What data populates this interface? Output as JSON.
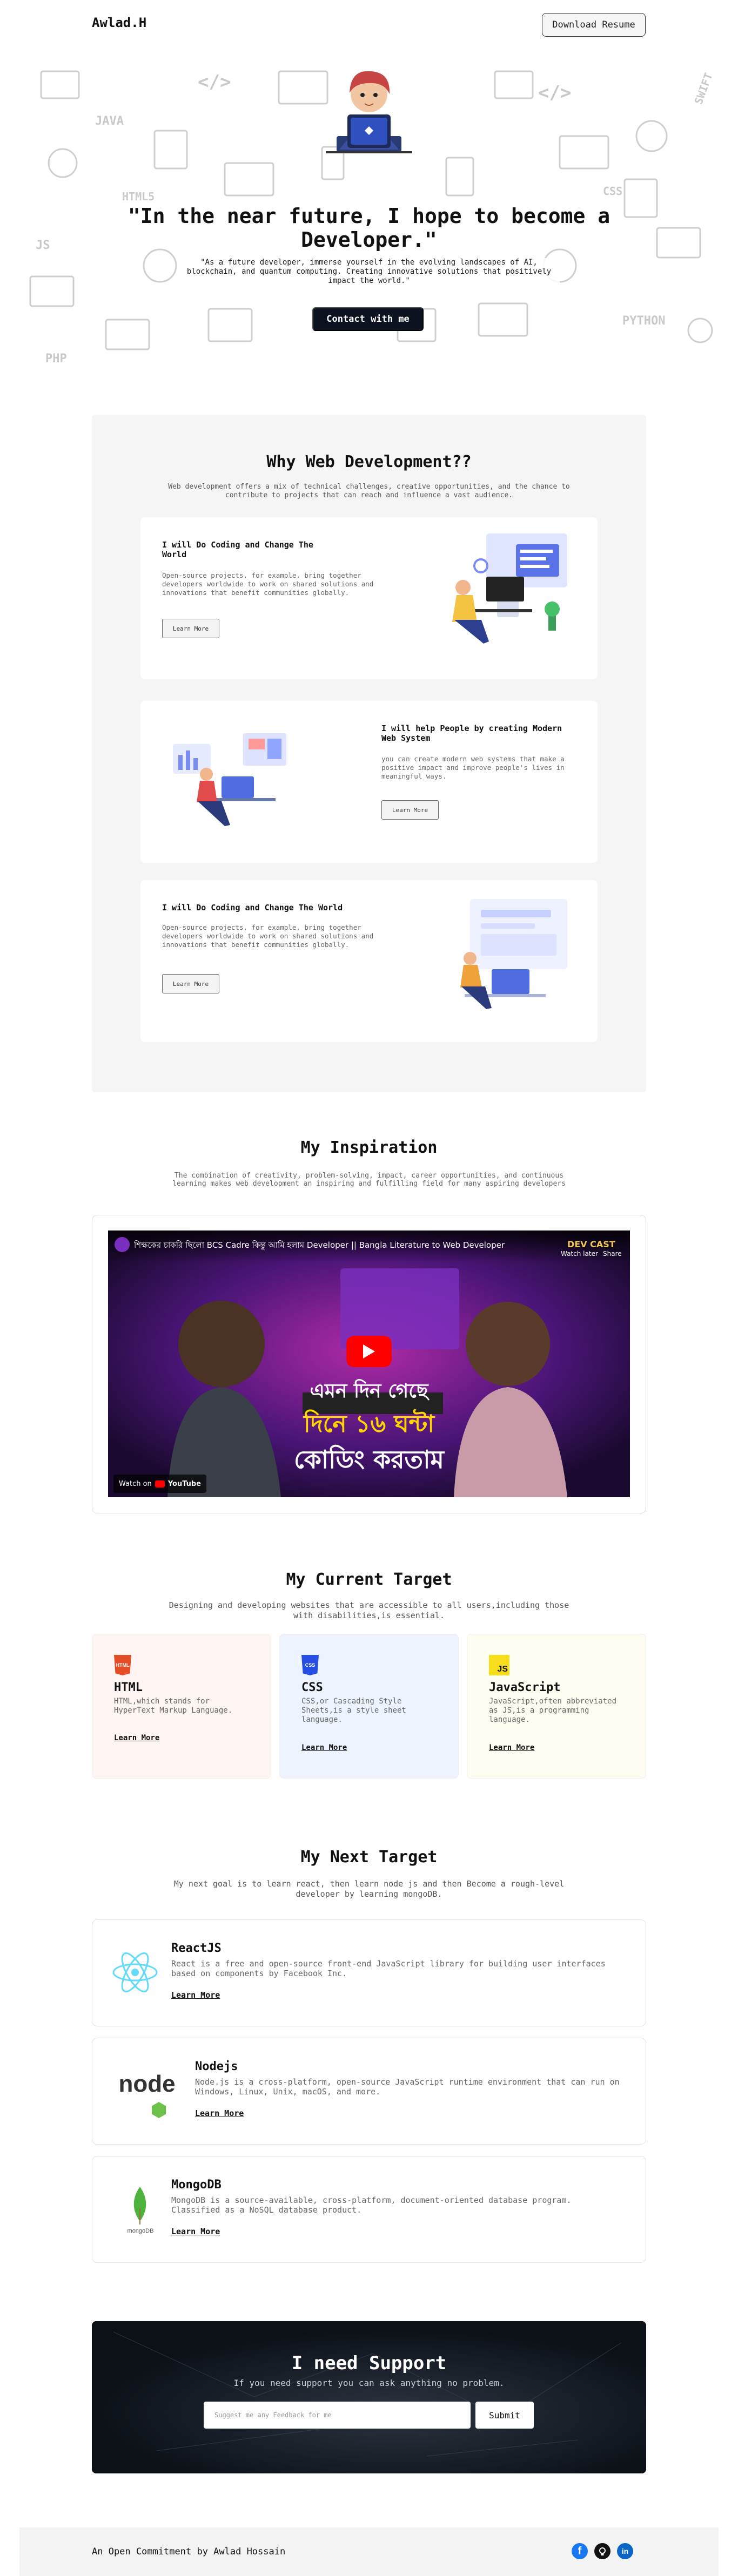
{
  "nav": {
    "logo": "Awlad.H",
    "download_label": "Download Resume"
  },
  "hero": {
    "quote": "\"In the near future, I hope to become a Developer.\"",
    "subtitle": "\"As a future developer, immerse yourself in the evolving landscapes of AI, blockchain, and quantum computing. Creating innovative solutions that positively impact the world.\"",
    "contact_label": "Contact with me",
    "doodles": [
      "JAVA",
      "PHP",
      "HTML5",
      "PYTHON",
      "SWIFT",
      "CSS",
      "JS",
      "</>"
    ]
  },
  "why": {
    "title": "Why Web Development??",
    "subtitle": "Web development offers a mix of technical challenges, creative opportunities, and the chance to contribute to projects that can reach and influence a vast audience.",
    "cards": [
      {
        "title": "I will Do Coding and Change The World",
        "text": "Open-source projects, for example, bring together developers worldwide to work on shared solutions and innovations that benefit communities globally.",
        "button": "Learn More"
      },
      {
        "title": "I will help People by creating Modern Web System",
        "text": "you can create modern web systems that make a positive impact and improve people's lives in meaningful ways.",
        "button": "Learn More"
      },
      {
        "title": "I will Do Coding and Change The World",
        "text": "Open-source projects, for example, bring together developers worldwide to work on shared solutions and innovations that benefit communities globally.",
        "button": "Learn More"
      }
    ]
  },
  "inspiration": {
    "title": "My Inspiration",
    "subtitle": "The combination of creativity, problem-solving, impact, career opportunities, and continuous learning makes web development an inspiring and fulfilling field for many aspiring developers",
    "video": {
      "title": "শিক্ষকের চাকরি ছিলো BCS Cadre কিন্তু আমি হলাম Developer || Bangla Literature to Web Developer",
      "watch_later": "Watch later",
      "share": "Share",
      "watch_on": "Watch on",
      "platform": "YouTube",
      "banner_line1": "এমন দিন গেছে",
      "banner_line2": "দিনে ১৬ ঘন্টা",
      "banner_line3": "কোডিং করতাম",
      "badge": "DEV CAST"
    }
  },
  "target": {
    "title": "My Current Target",
    "subtitle": "Designing and developing websites that are accessible to all users,including those with disabilities,is essential.",
    "cards": [
      {
        "icon_text": "HTML",
        "name": "HTML",
        "text": "HTML,which stands for HyperText Markup Language.",
        "link": "Learn More",
        "bg": "#fff5f2",
        "accent": "#e44d26"
      },
      {
        "icon_text": "CSS",
        "name": "CSS",
        "text": "CSS,or Cascading Style Sheets,is a style sheet language.",
        "link": "Learn More",
        "bg": "#eef4ff",
        "accent": "#264de4"
      },
      {
        "icon_text": "JS",
        "name": "JavaScript",
        "text": "JavaScript,often abbreviated as JS,is a programming language.",
        "link": "Learn More",
        "bg": "#fffdf1",
        "accent": "#f7df1e"
      }
    ]
  },
  "next": {
    "title": "My Next Target",
    "subtitle": "My next goal is to learn react, then learn node js and then Become a rough-level developer by learning mongoDB.",
    "cards": [
      {
        "name": "ReactJS",
        "text": "React is a free and open-source front-end JavaScript library for building user interfaces based on components by Facebook Inc.",
        "link": "Learn More"
      },
      {
        "name": "Nodejs",
        "text": "Node.js is a cross-platform, open-source JavaScript runtime environment that can run on Windows, Linux, Unix, macOS, and more.",
        "link": "Learn More",
        "logo_text": "node"
      },
      {
        "name": "MongoDB",
        "text": "MongoDB is a source-available, cross-platform, document-oriented database program. Classified as a NoSQL database product.",
        "link": "Learn More",
        "logo_text": "mongoDB"
      }
    ]
  },
  "support": {
    "title": "I need Support",
    "subtitle": "If you need support you can ask anything no problem.",
    "placeholder": "Suggest me any Feedback for me",
    "submit": "Submit"
  },
  "footer": {
    "text": "An Open Commitment by Awlad Hossain",
    "social": [
      "facebook-icon",
      "github-icon",
      "linkedin-icon"
    ],
    "facebook_glyph": "f",
    "linkedin_glyph": "in"
  },
  "colors": {
    "dark": "#0d1220",
    "facebook": "#1877f2",
    "github": "#111111",
    "linkedin": "#0a66c2"
  }
}
